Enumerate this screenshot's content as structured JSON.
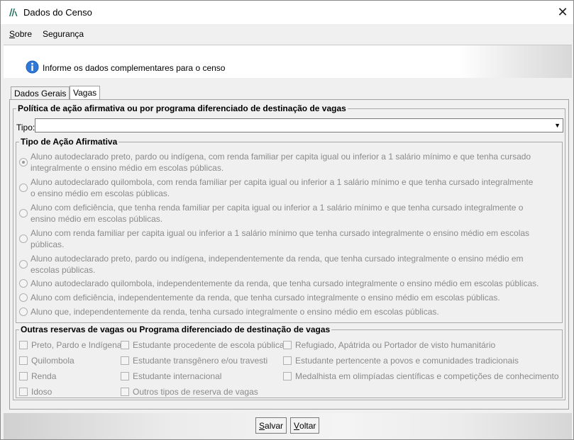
{
  "window": {
    "title": "Dados do Censo"
  },
  "menu": {
    "items": [
      "Sobre",
      "Segurança"
    ]
  },
  "banner": {
    "text": "Informe os dados complementares para o censo"
  },
  "tabs": [
    {
      "label": "Dados Gerais"
    },
    {
      "label": "Vagas"
    }
  ],
  "politica": {
    "legend": "Política de ação afirmativa ou por programa diferenciado de destinação de vagas",
    "tipo_label": "Tipo:",
    "tipo_value": ""
  },
  "acao": {
    "legend": "Tipo de Ação Afirmativa",
    "options": [
      {
        "lines": [
          "Aluno autodeclarado preto, pardo ou indígena, com renda familiar per capita igual ou inferior a 1 salário mínimo e que tenha cursado",
          "integralmente o ensino médio em escolas públicas."
        ],
        "checked": true
      },
      {
        "lines": [
          "Aluno autodeclarado quilombola, com renda familiar per capita igual ou inferior a 1 salário mínimo e que tenha cursado integralmente",
          "o ensino médio em escolas públicas."
        ],
        "checked": false
      },
      {
        "lines": [
          "Aluno com deficiência, que tenha renda familiar per capita igual ou inferior a 1 salário mínimo e que tenha cursado integralmente o",
          "ensino médio em escolas públicas."
        ],
        "checked": false
      },
      {
        "lines": [
          "Aluno com renda familiar per capita igual ou inferior a 1 salário mínimo que tenha cursado integralmente o ensino médio em escolas",
          "públicas."
        ],
        "checked": false
      },
      {
        "lines": [
          "Aluno autodeclarado preto, pardo ou indígena, independentemente da renda, que tenha cursado integralmente o ensino médio em",
          "escolas públicas."
        ],
        "checked": false
      },
      {
        "lines": [
          "Aluno autodeclarado quilombola, independentemente da renda, que tenha cursado integralmente o ensino médio em escolas públicas."
        ],
        "checked": false
      },
      {
        "lines": [
          "Aluno com deficiência, independentemente da renda, que tenha cursado integralmente o ensino médio em escolas públicas."
        ],
        "checked": false
      },
      {
        "lines": [
          "Aluno que, independentemente da renda, tenha cursado integralmente o ensino médio em escolas públicas."
        ],
        "checked": false
      }
    ]
  },
  "outras": {
    "legend": "Outras reservas de vagas ou Programa diferenciado de destinação de vagas",
    "col1": [
      "Preto, Pardo e Indígena",
      "Quilombola",
      "Renda",
      "Idoso"
    ],
    "col2": [
      "Estudante procedente de escola pública",
      "Estudante transgênero e/ou travesti",
      "Estudante internacional",
      "Outros tipos de reserva de vagas"
    ],
    "col3": [
      "Refugiado, Apátrida ou Portador de visto humanitário",
      "Estudante pertencente a povos e comunidades tradicionais",
      "Medalhista em olimpíadas científicas e competições de conhecimento"
    ]
  },
  "buttons": {
    "save_prefix": "S",
    "save_rest": "alvar",
    "back_prefix": "V",
    "back_rest": "oltar"
  }
}
